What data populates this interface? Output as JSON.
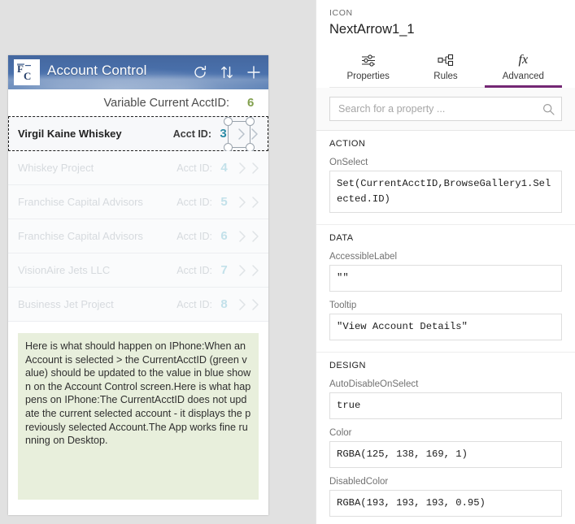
{
  "app": {
    "title": "Account Control",
    "logo_letters": "FC",
    "header_icons": [
      "refresh-icon",
      "sort-icon",
      "add-icon"
    ],
    "variable_row": {
      "label": "Variable Current AcctID:",
      "value": "6",
      "value_color": "#82a04e"
    },
    "gallery": {
      "acct_label": "Acct ID:",
      "selected_id_color": "#2b8ba6",
      "rows": [
        {
          "name": "Virgil Kaine Whiskey",
          "acct_label": "Acct ID:",
          "acct_id": "3",
          "selected": true
        },
        {
          "name": "Whiskey Project",
          "acct_label": "Acct ID:",
          "acct_id": "4",
          "selected": false
        },
        {
          "name": "Franchise Capital Advisors",
          "acct_label": "Acct ID:",
          "acct_id": "5",
          "selected": false
        },
        {
          "name": "Franchise Capital Advisors",
          "acct_label": "Acct ID:",
          "acct_id": "6",
          "selected": false
        },
        {
          "name": "VisionAire Jets LLC",
          "acct_label": "Acct ID:",
          "acct_id": "7",
          "selected": false
        },
        {
          "name": "Business Jet Project",
          "acct_label": "Acct ID:",
          "acct_id": "8",
          "selected": false
        }
      ]
    },
    "note": {
      "text": "Here is what should happen on IPhone:When an Account is selected > the CurrentAcctID (green value) should be updated to the value in blue shown on the Account Control screen.Here is what happens on IPhone:The CurrentAcctID does not update the current selected account - it displays the previously selected Account.The App works fine running on Desktop.",
      "background": "#e8efdc"
    }
  },
  "panel": {
    "kind": "ICON",
    "control_name": "NextArrow1_1",
    "accent_color": "#742774",
    "tabs": [
      {
        "label": "Properties",
        "icon": "sliders-icon",
        "active": false
      },
      {
        "label": "Rules",
        "icon": "hierarchy-icon",
        "active": false
      },
      {
        "label": "Advanced",
        "icon": "fx-icon",
        "active": true
      }
    ],
    "search": {
      "placeholder": "Search for a property ...",
      "value": "",
      "icon": "search-icon"
    },
    "sections": [
      {
        "title": "ACTION",
        "properties": [
          {
            "label": "OnSelect",
            "value": "Set(CurrentAcctID,BrowseGallery1.Selected.ID)"
          }
        ]
      },
      {
        "title": "DATA",
        "properties": [
          {
            "label": "AccessibleLabel",
            "value": "\"\""
          },
          {
            "label": "Tooltip",
            "value": "\"View Account Details\""
          }
        ]
      },
      {
        "title": "DESIGN",
        "properties": [
          {
            "label": "AutoDisableOnSelect",
            "value": "true"
          },
          {
            "label": "Color",
            "value": "RGBA(125, 138, 169, 1)"
          },
          {
            "label": "DisabledColor",
            "value": "RGBA(193, 193, 193, 0.95)"
          }
        ]
      }
    ]
  }
}
